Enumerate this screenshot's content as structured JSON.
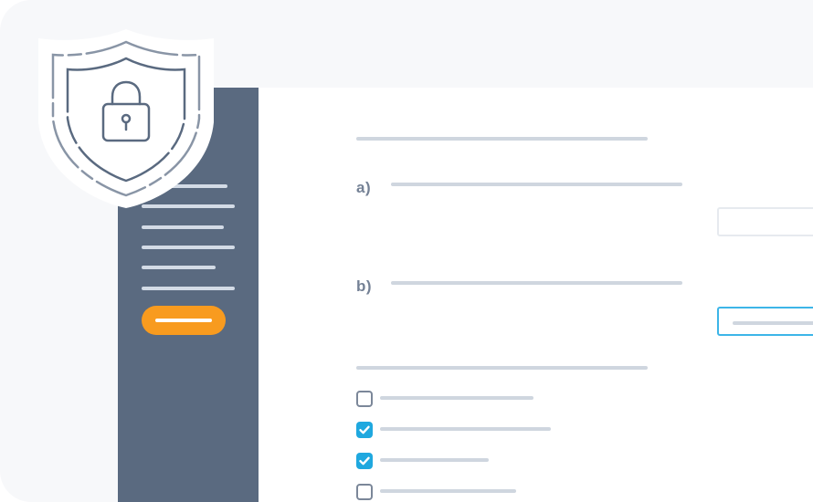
{
  "form": {
    "items": [
      {
        "label": "a)"
      },
      {
        "label": "b)"
      }
    ],
    "checkboxes": [
      {
        "checked": false
      },
      {
        "checked": true
      },
      {
        "checked": true
      },
      {
        "checked": false
      }
    ]
  },
  "icons": {
    "security": "shield-icon",
    "lock": "padlock-icon"
  },
  "colors": {
    "canvas_bg": "#f7f8fa",
    "sidebar_bg": "#5a6a80",
    "sidebar_lines": "#d3dbe6",
    "accent_button": "#f89b1f",
    "placeholder_lines": "#cfd6df",
    "item_labels": "#748195",
    "focus_border": "#3db5e8",
    "checkbox_checked": "#1fa8df",
    "checkbox_border": "#7b8799",
    "shield_outline": "#5a6a80"
  }
}
